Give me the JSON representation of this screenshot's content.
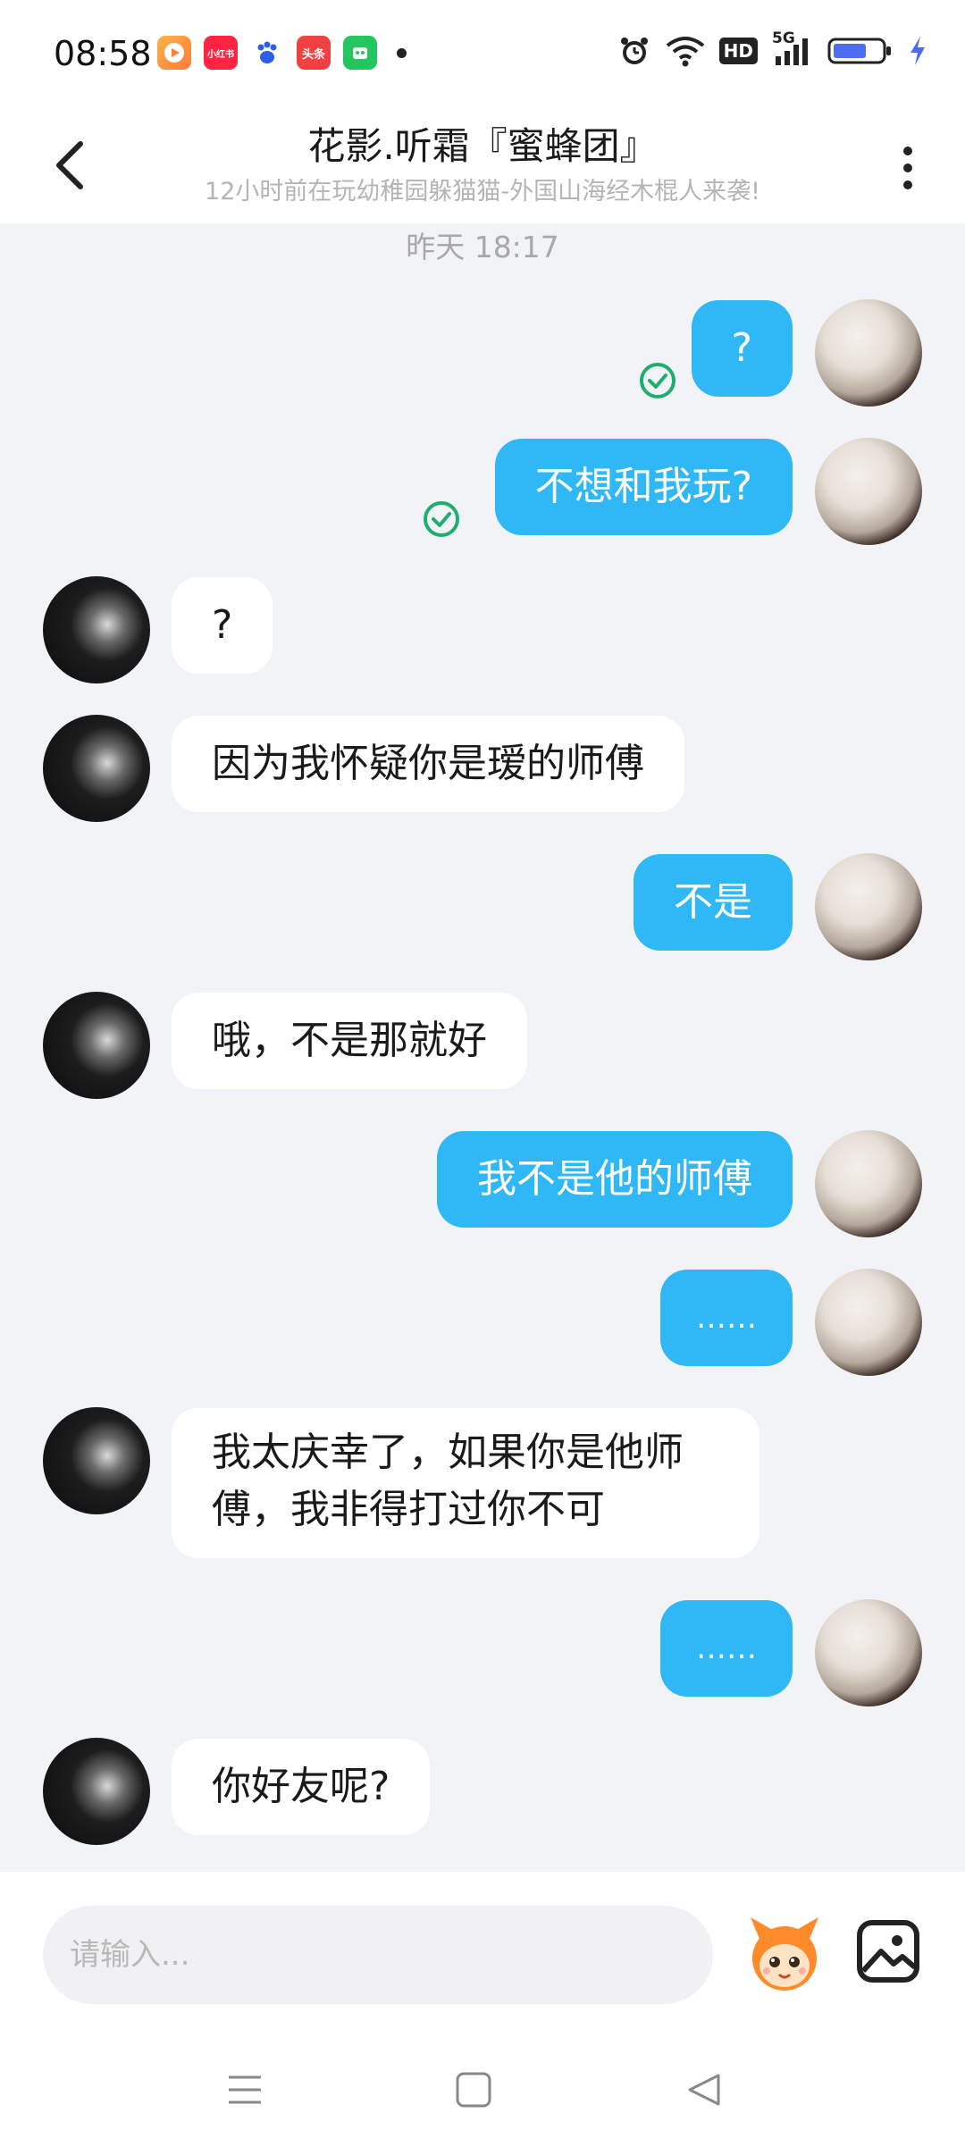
{
  "status_bar": {
    "time": "08:58",
    "notification_icons": [
      "video-app-icon",
      "xiaohongshu-icon",
      "baidu-icon",
      "toutiao-icon",
      "green-app-icon"
    ],
    "notif_labels": {
      "xhs": "小红书",
      "toutiao": "头条"
    },
    "network": "5G",
    "hd": "HD",
    "colors": {
      "battery_fill": "#4d6df0",
      "charging": "#4d6df0"
    }
  },
  "header": {
    "title": "花影.听霜『蜜蜂团』",
    "subtitle": "12小时前在玩幼稚园躲猫猫-外国山海经木棍人来袭!"
  },
  "chat": {
    "timestamp": "昨天 18:17",
    "colors": {
      "outgoing_bubble": "#2fb8f5",
      "incoming_bubble": "#ffffff",
      "background": "#f2f3f7",
      "read_check": "#1fae6e"
    },
    "messages": [
      {
        "direction": "out",
        "text": "?",
        "read": true
      },
      {
        "direction": "out",
        "text": "不想和我玩?",
        "read": true
      },
      {
        "direction": "in",
        "text": "?"
      },
      {
        "direction": "in",
        "text": "因为我怀疑你是瑷的师傅"
      },
      {
        "direction": "out",
        "text": "不是"
      },
      {
        "direction": "in",
        "text": "哦，不是那就好"
      },
      {
        "direction": "out",
        "text": "我不是他的师傅"
      },
      {
        "direction": "out",
        "text": "……"
      },
      {
        "direction": "in",
        "text": "我太庆幸了，如果你是他师傅，我非得打过你不可"
      },
      {
        "direction": "out",
        "text": "……"
      },
      {
        "direction": "in",
        "text": "你好友呢?"
      }
    ]
  },
  "input": {
    "placeholder": "请输入..."
  },
  "nav": {
    "buttons": [
      "menu-icon",
      "home-icon",
      "back-triangle-icon"
    ]
  }
}
